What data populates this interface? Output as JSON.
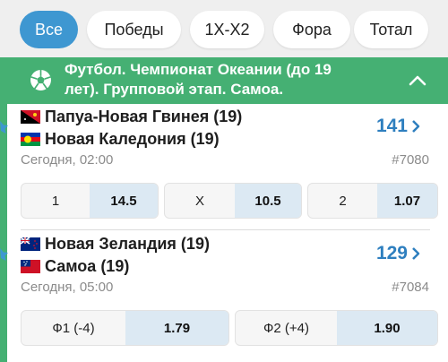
{
  "tabs": [
    {
      "label": "Все",
      "active": true
    },
    {
      "label": "Победы",
      "active": false
    },
    {
      "label": "1X-X2",
      "active": false
    },
    {
      "label": "Фора",
      "active": false
    },
    {
      "label": "Тотал",
      "active": false
    }
  ],
  "league": {
    "title": "Футбол. Чемпионат Океании (до 19 лет). Групповой этап. Самоа.",
    "icon": "soccer-ball-icon",
    "collapse_icon": "chevron-up-icon"
  },
  "matches": [
    {
      "team1": "Папуа-Новая Гвинея (19)",
      "team2": "Новая Каледония (19)",
      "bets_count": "141",
      "time": "Сегодня, 02:00",
      "id": "#7080",
      "odds": [
        {
          "label": "1",
          "value": "14.5"
        },
        {
          "label": "X",
          "value": "10.5"
        },
        {
          "label": "2",
          "value": "1.07"
        }
      ]
    },
    {
      "team1": "Новая Зеландия (19)",
      "team2": "Самоа (19)",
      "bets_count": "129",
      "time": "Сегодня, 05:00",
      "id": "#7084",
      "odds": [
        {
          "label": "Ф1 (-4)",
          "value": "1.79"
        },
        {
          "label": "Ф2 (+4)",
          "value": "1.90"
        }
      ]
    }
  ],
  "colors": {
    "accent": "#3e97d1",
    "league_green": "#45b073",
    "count_blue": "#2e7fbf",
    "odd_value_bg": "#dce9f3"
  }
}
